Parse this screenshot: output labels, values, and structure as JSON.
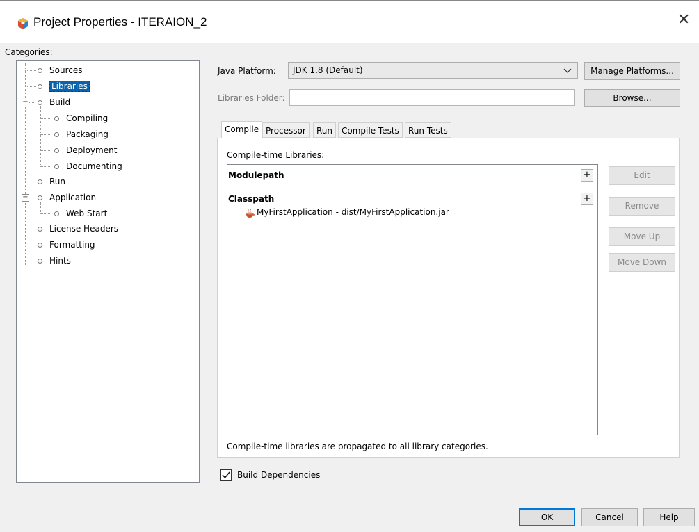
{
  "window": {
    "title": "Project Properties - ITERAION_2",
    "app_icon": "netbeans-cube-icon",
    "close_glyph": "✕"
  },
  "categories": {
    "label": "Categories:",
    "items": [
      {
        "label": "Sources"
      },
      {
        "label": "Libraries"
      },
      {
        "label": "Build"
      },
      {
        "label": "Compiling"
      },
      {
        "label": "Packaging"
      },
      {
        "label": "Deployment"
      },
      {
        "label": "Documenting"
      },
      {
        "label": "Run"
      },
      {
        "label": "Application"
      },
      {
        "label": "Web Start"
      },
      {
        "label": "License Headers"
      },
      {
        "label": "Formatting"
      },
      {
        "label": "Hints"
      }
    ],
    "selected": "Libraries"
  },
  "platform": {
    "label": "Java Platform:",
    "value": "JDK 1.8 (Default)",
    "manage_button": "Manage Platforms...",
    "folder_label": "Libraries Folder:",
    "folder_value": "",
    "browse_button": "Browse..."
  },
  "tabs": [
    {
      "label": "Compile",
      "active": true
    },
    {
      "label": "Processor"
    },
    {
      "label": "Run"
    },
    {
      "label": "Compile Tests"
    },
    {
      "label": "Run Tests"
    }
  ],
  "compile": {
    "list_label": "Compile-time Libraries:",
    "modulepath_header": "Modulepath",
    "classpath_header": "Classpath",
    "classpath_entry": "MyFirstApplication - dist/MyFirstApplication.jar",
    "plus": "+",
    "note": "Compile-time libraries are propagated to all library categories.",
    "side_buttons": {
      "edit": "Edit",
      "remove": "Remove",
      "move_up": "Move Up",
      "move_down": "Move Down"
    }
  },
  "build_dependencies": {
    "label": "Build Dependencies",
    "checked": true
  },
  "footer": {
    "ok": "OK",
    "cancel": "Cancel",
    "help": "Help"
  },
  "colors": {
    "selection": "#0a64ad",
    "jar_icon": "#c8502a"
  }
}
